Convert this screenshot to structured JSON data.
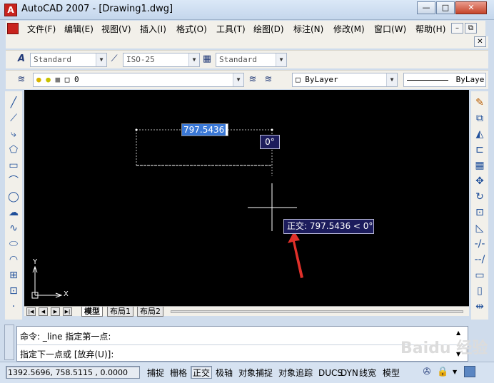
{
  "window": {
    "app_icon_letter": "A",
    "title": "AutoCAD 2007 - [Drawing1.dwg]",
    "minimize": "—",
    "maximize": "□",
    "close": "✕"
  },
  "menu": {
    "items": [
      "文件(F)",
      "编辑(E)",
      "视图(V)",
      "插入(I)",
      "格式(O)",
      "工具(T)",
      "绘图(D)",
      "标注(N)",
      "修改(M)",
      "窗口(W)",
      "帮助(H)"
    ],
    "doc_min": "–",
    "doc_restore": "⧉",
    "doc_close": "✕"
  },
  "styles_toolbar": {
    "text_style": "Standard",
    "dim_style": "ISO-25",
    "table_style": "Standard"
  },
  "layers_toolbar": {
    "current_layer": "0",
    "color": "ByLayer",
    "linetype": "ByLayer"
  },
  "canvas": {
    "length_input": "797.5436",
    "angle_tooltip": "0°",
    "ortho_tooltip": "正交: 797.5436 < 0°",
    "ucs_x": "X",
    "ucs_y": "Y",
    "colors": {
      "background": "#000000",
      "tooltip_bg": "#1c1c5c",
      "input_bg": "#3a78d6",
      "arrow": "#e0302a"
    }
  },
  "layout_tabs": {
    "nav": [
      "|◀",
      "◀",
      "▶",
      "▶|"
    ],
    "tabs": [
      "模型",
      "布局1",
      "布局2"
    ]
  },
  "command": {
    "history_line": "命令: _line 指定第一点:",
    "prompt_line": "指定下一点或 [放弃(U)]:"
  },
  "status": {
    "coordinates": "1392.5696, 758.5115 , 0.0000",
    "toggles": [
      {
        "label": "捕捉",
        "on": false
      },
      {
        "label": "栅格",
        "on": false
      },
      {
        "label": "正交",
        "on": true
      },
      {
        "label": "极轴",
        "on": false
      },
      {
        "label": "对象捕捉",
        "on": false
      },
      {
        "label": "对象追踪",
        "on": false
      },
      {
        "label": "DUCS",
        "on": false
      },
      {
        "label": "DYN",
        "on": false
      },
      {
        "label": "线宽",
        "on": false
      },
      {
        "label": "模型",
        "on": false
      }
    ]
  },
  "watermark": "Baidu 经验"
}
